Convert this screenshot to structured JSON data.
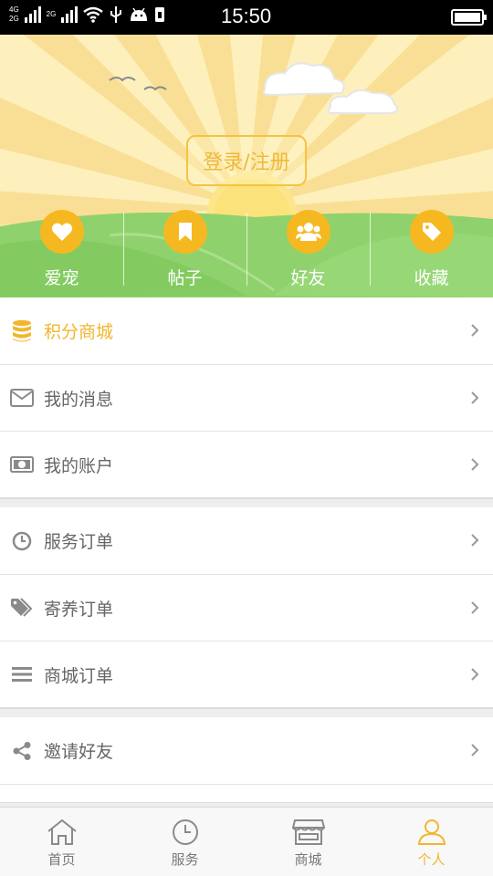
{
  "status_bar": {
    "net_top": "4G",
    "net_bottom": "2G",
    "net2_label": "2G",
    "time": "15:50"
  },
  "header": {
    "login_label": "登录/注册",
    "quick_links": [
      {
        "label": "爱宠",
        "icon": "heart-icon"
      },
      {
        "label": "帖子",
        "icon": "bookmark-icon"
      },
      {
        "label": "好友",
        "icon": "friends-icon"
      },
      {
        "label": "收藏",
        "icon": "tag-icon"
      }
    ]
  },
  "menu": {
    "group1": [
      {
        "label": "积分商城",
        "icon": "coins-icon",
        "highlight": true
      },
      {
        "label": "我的消息",
        "icon": "mail-icon"
      },
      {
        "label": "我的账户",
        "icon": "banknote-icon"
      }
    ],
    "group2": [
      {
        "label": "服务订单",
        "icon": "clock-icon"
      },
      {
        "label": "寄养订单",
        "icon": "tags-icon"
      },
      {
        "label": "商城订单",
        "icon": "list-icon"
      }
    ],
    "group3": [
      {
        "label": "邀请好友",
        "icon": "share-icon"
      }
    ]
  },
  "tabbar": {
    "tabs": [
      {
        "label": "首页",
        "icon": "home-icon"
      },
      {
        "label": "服务",
        "icon": "clock-icon"
      },
      {
        "label": "商城",
        "icon": "store-icon"
      },
      {
        "label": "个人",
        "icon": "person-icon",
        "active": true
      }
    ]
  },
  "colors": {
    "accent": "#f2b62d",
    "icon_gray": "#8a8a8a",
    "grass": "#8cd36a"
  }
}
